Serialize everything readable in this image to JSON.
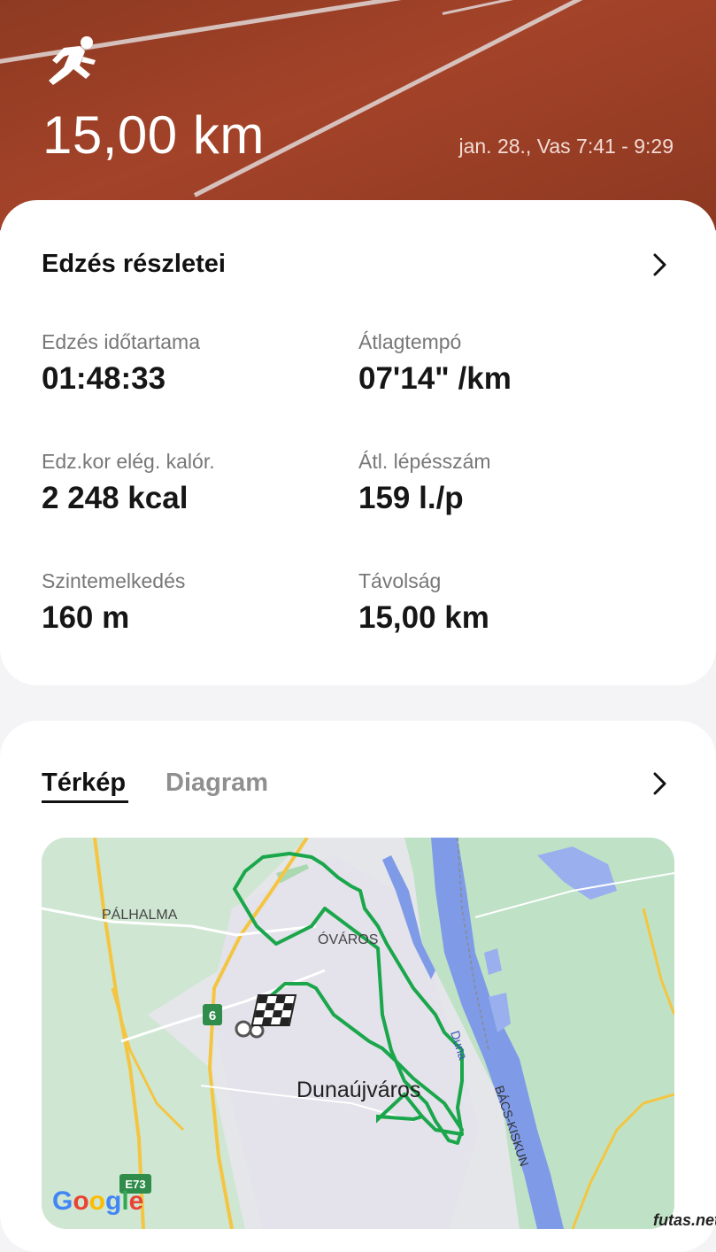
{
  "header": {
    "distance": "15,00 km",
    "datetime": "jan. 28., Vas 7:41 - 9:29",
    "icon": "running-icon"
  },
  "details": {
    "title": "Edzés részletei",
    "stats": [
      {
        "label": "Edzés időtartama",
        "value": "01:48:33"
      },
      {
        "label": "Átlagtempó",
        "value": "07'14\" /km"
      },
      {
        "label": "Edz.kor elég. kalór.",
        "value": "2 248 kcal"
      },
      {
        "label": "Átl. lépésszám",
        "value": "159 l./p"
      },
      {
        "label": "Szintemelkedés",
        "value": "160 m"
      },
      {
        "label": "Távolság",
        "value": "15,00 km"
      }
    ]
  },
  "map_section": {
    "tabs": [
      {
        "label": "Térkép",
        "active": true
      },
      {
        "label": "Diagram",
        "active": false
      }
    ],
    "map": {
      "labels": {
        "palhalma": "PÁLHALMA",
        "ovaros": "ÓVÁROS",
        "city": "Dunaújváros",
        "river": "Duna",
        "county": "BÁCS-KISKUN",
        "road6": "6",
        "roadE73": "E73",
        "google": "Google"
      },
      "route_color": "#1aa64b",
      "river_color": "#7f9be8",
      "park_color": "#b7dfbf",
      "road_color": "#f4c542"
    }
  },
  "watermark": "futas.net"
}
